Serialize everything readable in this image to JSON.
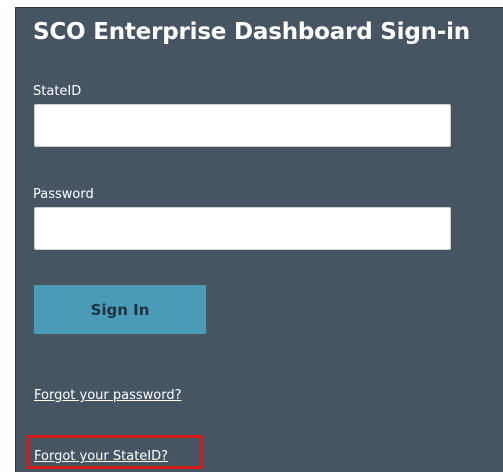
{
  "form": {
    "title": "SCO Enterprise Dashboard Sign-in",
    "stateid_label": "StateID",
    "stateid_value": "",
    "password_label": "Password",
    "password_value": "",
    "sign_in_label": "Sign In",
    "forgot_password_link": "Forgot your password?",
    "forgot_stateid_link": "Forgot your StateID?"
  },
  "colors": {
    "panel_background": "#465561",
    "sign_in_button": "#4a9bb8",
    "highlight_border": "#d21a1a"
  }
}
